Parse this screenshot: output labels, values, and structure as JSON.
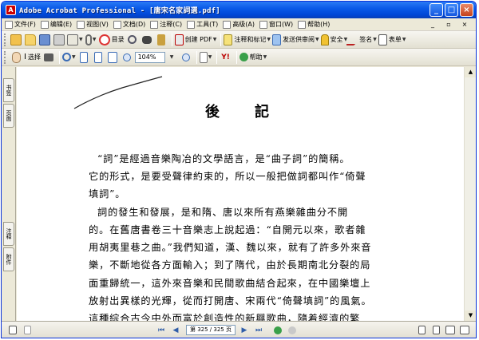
{
  "window": {
    "title": "Adobe Acrobat Professional - [唐宋名家詞選.pdf]",
    "app_icon": "acrobat-icon"
  },
  "menu": {
    "items": [
      "文件(F)",
      "编辑(E)",
      "视图(V)",
      "文档(D)",
      "注释(C)",
      "工具(T)",
      "高级(A)",
      "窗口(W)",
      "帮助(H)"
    ]
  },
  "toolbar1": {
    "create_pdf": "创建 PDF",
    "comment_markup": "注释和标记",
    "send_review": "发送供审阅",
    "secure": "安全",
    "sign": "签名",
    "forms": "表单",
    "grid_label": "目录"
  },
  "toolbar2": {
    "select_label": "选择",
    "zoom_value": "104%",
    "help_label": "帮助"
  },
  "left_tabs": [
    "书签",
    "页面",
    "注释",
    "附件"
  ],
  "document": {
    "heading": "後記",
    "lines": [
      "“詞”是經過音樂陶冶的文學語言，是“曲子詞”的簡稱。",
      "它的形式，是要受聲律約束的，所以一般把做詞都叫作“倚聲",
      "填詞”。",
      "詞的發生和發展，是和隋、唐以來所有燕樂雜曲分不開",
      "的。在舊唐書卷三十音樂志上說起過：“自開元以來，歌者雜",
      "用胡夷里巷之曲。”我們知道，漢、魏以來，就有了許多外來音",
      "樂，不斷地從各方面輸入；到了隋代，由於長期南北分裂的局",
      "面重歸統一，這外來音樂和民間歌曲結合起來，在中國樂壇上",
      "放射出異樣的光輝，從而打開唐、宋兩代“倚聲填詞”的風氣。",
      "這種綜合古今中外而富於創造性的新興歌曲，隨着經濟的繁"
    ]
  },
  "status": {
    "page_display": "第 325 / 325 页"
  },
  "colors": {
    "titlebar": "#0a5ae8",
    "close": "#c4421c",
    "toolbar": "#ece9d8"
  }
}
